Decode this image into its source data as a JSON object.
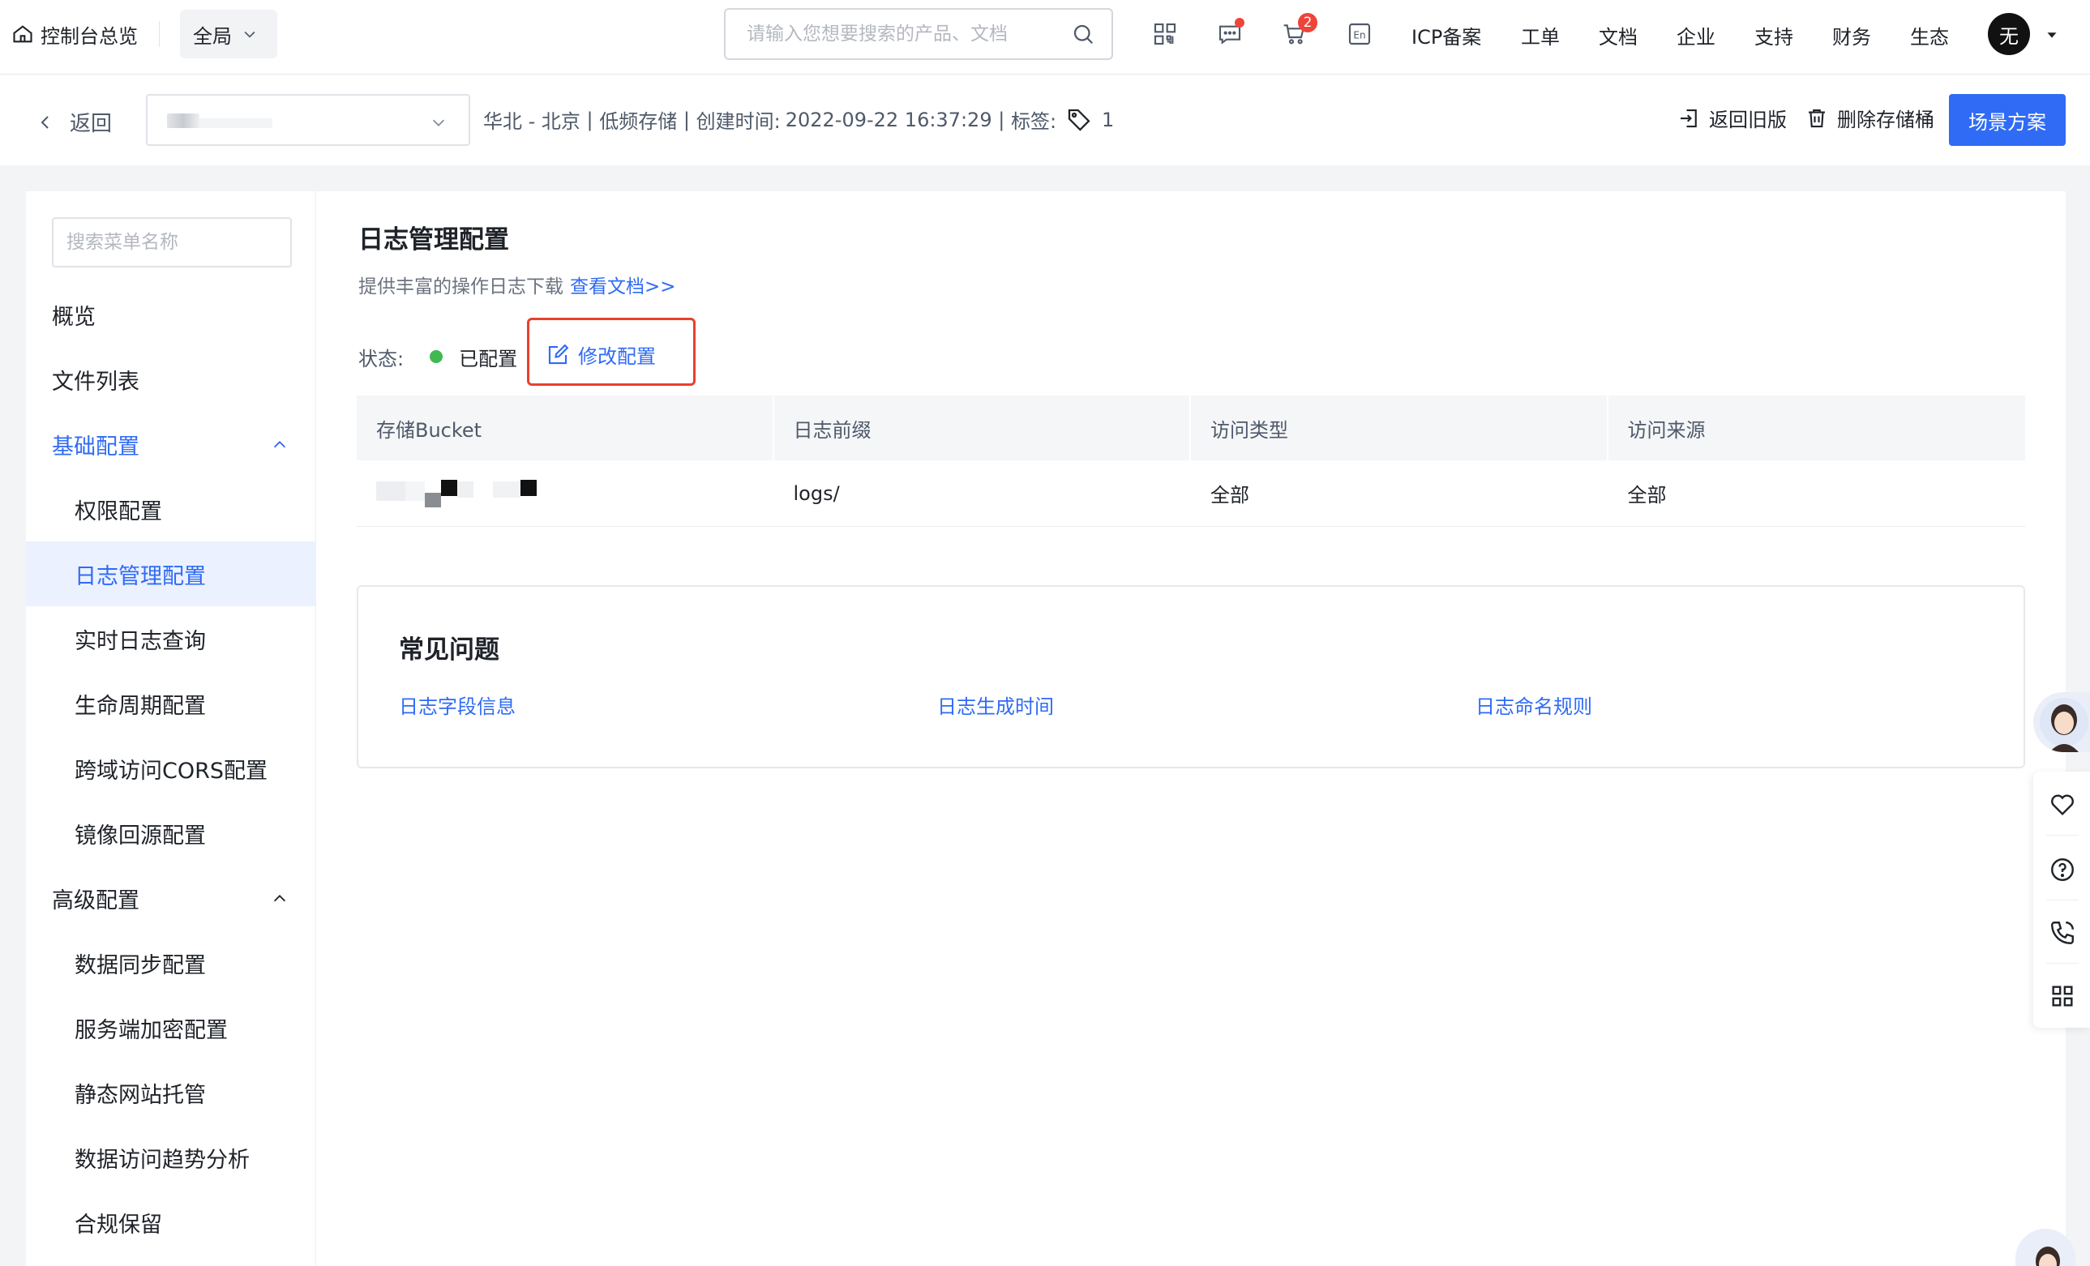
{
  "topbar": {
    "home_label": "控制台总览",
    "scope_label": "全局",
    "search_placeholder": "请输入您想要搜索的产品、文档",
    "cart_count": "2",
    "lang_icon_text": "En",
    "links": [
      "ICP备案",
      "工单",
      "文档",
      "企业",
      "支持",
      "财务",
      "生态"
    ],
    "avatar_text": "无"
  },
  "subbar": {
    "back_label": "返回",
    "bucket_meta": {
      "region": "华北 - 北京",
      "storage_class": "低频存储",
      "created_label": "创建时间:",
      "created_value": "2022-09-22 16:37:29",
      "tag_label": "标签:",
      "tag_count": "1"
    },
    "return_old_label": "返回旧版",
    "delete_label": "删除存储桶",
    "primary_label": "场景方案"
  },
  "sidebar": {
    "search_placeholder": "搜索菜单名称",
    "items": [
      {
        "label": "概览"
      },
      {
        "label": "文件列表"
      },
      {
        "label": "基础配置"
      },
      {
        "label": "权限配置"
      },
      {
        "label": "日志管理配置"
      },
      {
        "label": "实时日志查询"
      },
      {
        "label": "生命周期配置"
      },
      {
        "label": "跨域访问CORS配置"
      },
      {
        "label": "镜像回源配置"
      },
      {
        "label": "高级配置"
      },
      {
        "label": "数据同步配置"
      },
      {
        "label": "服务端加密配置"
      },
      {
        "label": "静态网站托管"
      },
      {
        "label": "数据访问趋势分析"
      },
      {
        "label": "合规保留"
      }
    ]
  },
  "main": {
    "title": "日志管理配置",
    "desc": "提供丰富的操作日志下载",
    "doc_link": "查看文档>>",
    "status_label": "状态:",
    "status_value": "已配置",
    "edit_label": "修改配置",
    "status_color": "#3fb950",
    "table": {
      "headers": [
        "存储Bucket",
        "日志前缀",
        "访问类型",
        "访问来源"
      ],
      "rows": [
        {
          "prefix": "logs/",
          "access_type": "全部",
          "access_source": "全部"
        }
      ]
    },
    "faq": {
      "title": "常见问题",
      "links": [
        "日志字段信息",
        "日志生成时间",
        "日志命名规则"
      ]
    }
  },
  "colors": {
    "accent": "#2f6bf5",
    "highlight_border": "#e8412c",
    "badge": "#f04438"
  }
}
